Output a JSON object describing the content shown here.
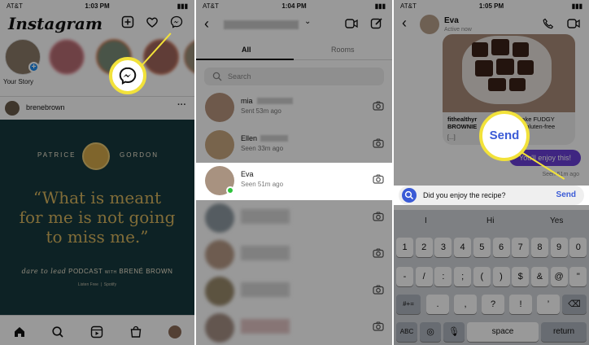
{
  "panel1": {
    "status": {
      "carrier": "AT&T",
      "time": "1:03 PM"
    },
    "app_title": "Instagram",
    "your_story_label": "Your Story",
    "post_username": "brenebrown",
    "post_more": "···",
    "post": {
      "name_left": "PATRICE",
      "name_right": "GORDON",
      "quote_line1": "“What is meant",
      "quote_line2": "for me is not going",
      "quote_line3": "to miss me.”",
      "podcast_left": "dare to lead",
      "podcast_mid": "PODCAST",
      "podcast_with": "WITH",
      "podcast_right": "BRENÉ BROWN",
      "listen_free": "Listen Free",
      "spotify": "Spotify"
    },
    "icons": [
      "new-post-icon",
      "heart-icon",
      "messenger-icon",
      "home-icon",
      "search-icon",
      "reels-icon",
      "shop-icon",
      "profile-icon"
    ]
  },
  "panel2": {
    "status": {
      "carrier": "AT&T",
      "time": "1:04 PM"
    },
    "tabs": [
      "All",
      "Rooms"
    ],
    "search_placeholder": "Search",
    "conversations": [
      {
        "name": "mia",
        "subtitle": "Sent 53m ago"
      },
      {
        "name": "Ellen",
        "subtitle": "Seen 33m ago"
      },
      {
        "name": "Eva",
        "subtitle": "Seen 51m ago"
      }
    ]
  },
  "panel3": {
    "status": {
      "carrier": "AT&T",
      "time": "1:05 PM"
    },
    "contact_name": "Eva",
    "contact_status": "Active now",
    "shared_post": {
      "line1": "fithealthyr",
      "line1b": "Bake FUDGY",
      "line2": "BROWNIE",
      "line2b": "se gluten-free",
      "more": "[...]"
    },
    "outgoing_message": "You'll enjoy this!",
    "seen_label": "Seen 51m ago",
    "composer_text": "Did you enjoy the recipe?",
    "send_label": "Send",
    "callout_label": "Send",
    "keyboard": {
      "suggestions": [
        "I",
        "Hi",
        "Yes"
      ],
      "row1": [
        "1",
        "2",
        "3",
        "4",
        "5",
        "6",
        "7",
        "8",
        "9",
        "0"
      ],
      "row2": [
        "-",
        "/",
        ":",
        ";",
        "(",
        ")",
        "$",
        "&",
        "@",
        "\""
      ],
      "row3_left": "#+=",
      "row3": [
        ".",
        ",",
        "?",
        "!",
        "’"
      ],
      "abc": "ABC",
      "space": "space",
      "return": "return"
    }
  }
}
